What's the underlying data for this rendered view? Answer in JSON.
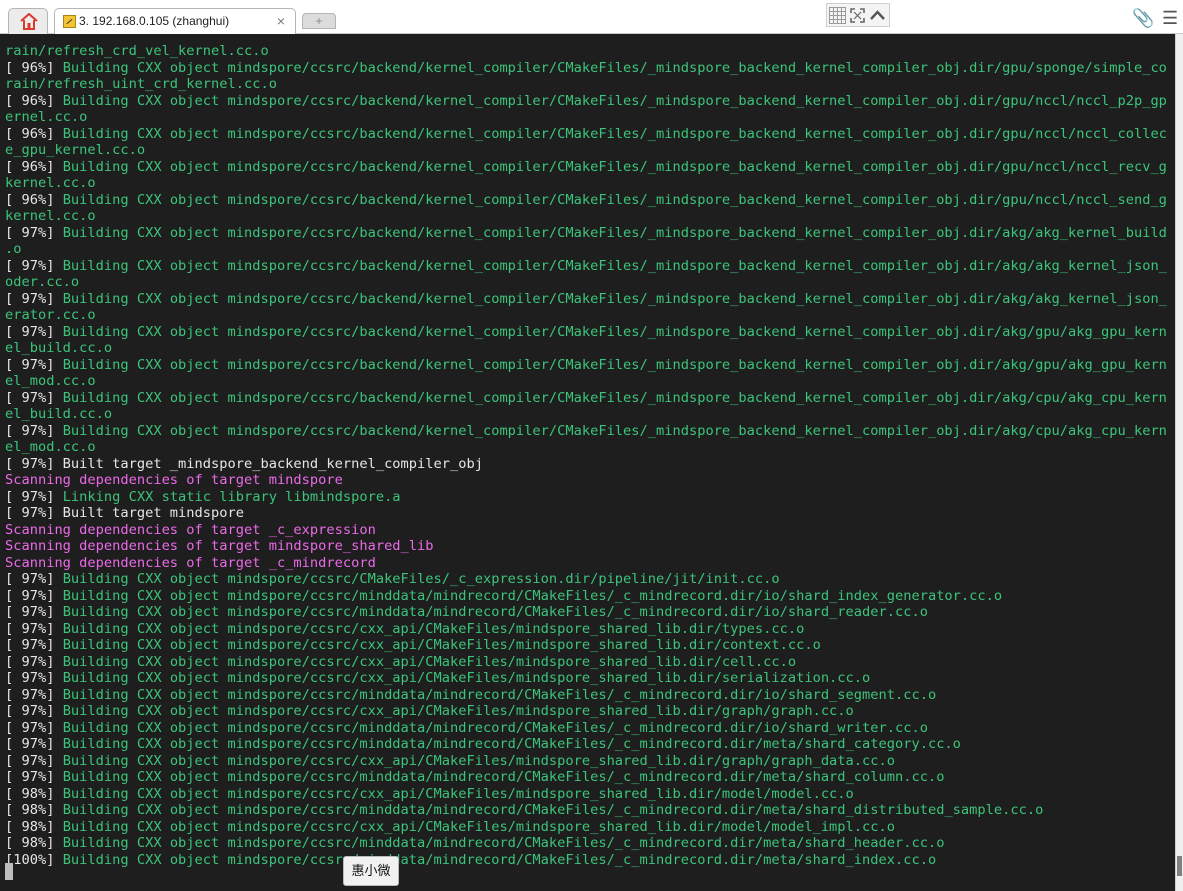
{
  "tabs": {
    "home_icon": "home-icon",
    "session_title": "3. 192.168.0.105 (zhanghui)",
    "close_glyph": "×",
    "new_tab_glyph": "+"
  },
  "toolbar": {
    "icons": [
      "grid-icon",
      "fullscreen-icon",
      "collapse-icon",
      "paperclip-icon",
      "menu-icon"
    ],
    "paperclip_glyph": "📎",
    "menu_glyph": "☰"
  },
  "colors": {
    "terminal_background": "#1e1e1e",
    "default_text": "#e6e6e6",
    "progress_text": "#3cc47a",
    "scanning_text": "#ea6ae8",
    "home_icon": "#d83a2e",
    "paperclip": "#3a6bc7"
  },
  "terminal": {
    "lines": [
      {
        "parts": [
          {
            "c": "green",
            "t": "rain/refresh_crd_vel_kernel.cc.o"
          }
        ]
      },
      {
        "parts": [
          {
            "c": "white",
            "t": "[ 96%] "
          },
          {
            "c": "green",
            "t": "Building CXX object mindspore/ccsrc/backend/kernel_compiler/CMakeFiles/_mindspore_backend_kernel_compiler_obj.dir/gpu/sponge/simple_co"
          }
        ]
      },
      {
        "parts": [
          {
            "c": "green",
            "t": "rain/refresh_uint_crd_kernel.cc.o"
          }
        ]
      },
      {
        "parts": [
          {
            "c": "white",
            "t": "[ 96%] "
          },
          {
            "c": "green",
            "t": "Building CXX object mindspore/ccsrc/backend/kernel_compiler/CMakeFiles/_mindspore_backend_kernel_compiler_obj.dir/gpu/nccl/nccl_p2p_gp"
          }
        ]
      },
      {
        "parts": [
          {
            "c": "green",
            "t": "ernel.cc.o"
          }
        ]
      },
      {
        "parts": [
          {
            "c": "white",
            "t": "[ 96%] "
          },
          {
            "c": "green",
            "t": "Building CXX object mindspore/ccsrc/backend/kernel_compiler/CMakeFiles/_mindspore_backend_kernel_compiler_obj.dir/gpu/nccl/nccl_collec"
          }
        ]
      },
      {
        "parts": [
          {
            "c": "green",
            "t": "e_gpu_kernel.cc.o"
          }
        ]
      },
      {
        "parts": [
          {
            "c": "white",
            "t": "[ 96%] "
          },
          {
            "c": "green",
            "t": "Building CXX object mindspore/ccsrc/backend/kernel_compiler/CMakeFiles/_mindspore_backend_kernel_compiler_obj.dir/gpu/nccl/nccl_recv_g"
          }
        ]
      },
      {
        "parts": [
          {
            "c": "green",
            "t": "kernel.cc.o"
          }
        ]
      },
      {
        "parts": [
          {
            "c": "white",
            "t": "[ 96%] "
          },
          {
            "c": "green",
            "t": "Building CXX object mindspore/ccsrc/backend/kernel_compiler/CMakeFiles/_mindspore_backend_kernel_compiler_obj.dir/gpu/nccl/nccl_send_g"
          }
        ]
      },
      {
        "parts": [
          {
            "c": "green",
            "t": "kernel.cc.o"
          }
        ]
      },
      {
        "parts": [
          {
            "c": "white",
            "t": "[ 97%] "
          },
          {
            "c": "green",
            "t": "Building CXX object mindspore/ccsrc/backend/kernel_compiler/CMakeFiles/_mindspore_backend_kernel_compiler_obj.dir/akg/akg_kernel_build"
          }
        ]
      },
      {
        "parts": [
          {
            "c": "green",
            "t": ".o"
          }
        ]
      },
      {
        "parts": [
          {
            "c": "white",
            "t": "[ 97%] "
          },
          {
            "c": "green",
            "t": "Building CXX object mindspore/ccsrc/backend/kernel_compiler/CMakeFiles/_mindspore_backend_kernel_compiler_obj.dir/akg/akg_kernel_json_"
          }
        ]
      },
      {
        "parts": [
          {
            "c": "green",
            "t": "oder.cc.o"
          }
        ]
      },
      {
        "parts": [
          {
            "c": "white",
            "t": "[ 97%] "
          },
          {
            "c": "green",
            "t": "Building CXX object mindspore/ccsrc/backend/kernel_compiler/CMakeFiles/_mindspore_backend_kernel_compiler_obj.dir/akg/akg_kernel_json_"
          }
        ]
      },
      {
        "parts": [
          {
            "c": "green",
            "t": "erator.cc.o"
          }
        ]
      },
      {
        "parts": [
          {
            "c": "white",
            "t": "[ 97%] "
          },
          {
            "c": "green",
            "t": "Building CXX object mindspore/ccsrc/backend/kernel_compiler/CMakeFiles/_mindspore_backend_kernel_compiler_obj.dir/akg/gpu/akg_gpu_kern"
          }
        ]
      },
      {
        "parts": [
          {
            "c": "green",
            "t": "el_build.cc.o"
          }
        ]
      },
      {
        "parts": [
          {
            "c": "white",
            "t": "[ 97%] "
          },
          {
            "c": "green",
            "t": "Building CXX object mindspore/ccsrc/backend/kernel_compiler/CMakeFiles/_mindspore_backend_kernel_compiler_obj.dir/akg/gpu/akg_gpu_kern"
          }
        ]
      },
      {
        "parts": [
          {
            "c": "green",
            "t": "el_mod.cc.o"
          }
        ]
      },
      {
        "parts": [
          {
            "c": "white",
            "t": "[ 97%] "
          },
          {
            "c": "green",
            "t": "Building CXX object mindspore/ccsrc/backend/kernel_compiler/CMakeFiles/_mindspore_backend_kernel_compiler_obj.dir/akg/cpu/akg_cpu_kern"
          }
        ]
      },
      {
        "parts": [
          {
            "c": "green",
            "t": "el_build.cc.o"
          }
        ]
      },
      {
        "parts": [
          {
            "c": "white",
            "t": "[ 97%] "
          },
          {
            "c": "green",
            "t": "Building CXX object mindspore/ccsrc/backend/kernel_compiler/CMakeFiles/_mindspore_backend_kernel_compiler_obj.dir/akg/cpu/akg_cpu_kern"
          }
        ]
      },
      {
        "parts": [
          {
            "c": "green",
            "t": "el_mod.cc.o"
          }
        ]
      },
      {
        "parts": [
          {
            "c": "white",
            "t": "[ 97%] Built target _mindspore_backend_kernel_compiler_obj"
          }
        ]
      },
      {
        "parts": [
          {
            "c": "magenta",
            "t": "Scanning dependencies of target mindspore"
          }
        ]
      },
      {
        "parts": [
          {
            "c": "white",
            "t": "[ 97%] "
          },
          {
            "c": "green",
            "t": "Linking CXX static library libmindspore.a"
          }
        ]
      },
      {
        "parts": [
          {
            "c": "white",
            "t": "[ 97%] Built target mindspore"
          }
        ]
      },
      {
        "parts": [
          {
            "c": "magenta",
            "t": "Scanning dependencies of target _c_expression"
          }
        ]
      },
      {
        "parts": [
          {
            "c": "magenta",
            "t": "Scanning dependencies of target mindspore_shared_lib"
          }
        ]
      },
      {
        "parts": [
          {
            "c": "magenta",
            "t": "Scanning dependencies of target _c_mindrecord"
          }
        ]
      },
      {
        "parts": [
          {
            "c": "white",
            "t": "[ 97%] "
          },
          {
            "c": "green",
            "t": "Building CXX object mindspore/ccsrc/CMakeFiles/_c_expression.dir/pipeline/jit/init.cc.o"
          }
        ]
      },
      {
        "parts": [
          {
            "c": "white",
            "t": "[ 97%] "
          },
          {
            "c": "green",
            "t": "Building CXX object mindspore/ccsrc/minddata/mindrecord/CMakeFiles/_c_mindrecord.dir/io/shard_index_generator.cc.o"
          }
        ]
      },
      {
        "parts": [
          {
            "c": "white",
            "t": "[ 97%] "
          },
          {
            "c": "green",
            "t": "Building CXX object mindspore/ccsrc/minddata/mindrecord/CMakeFiles/_c_mindrecord.dir/io/shard_reader.cc.o"
          }
        ]
      },
      {
        "parts": [
          {
            "c": "white",
            "t": "[ 97%] "
          },
          {
            "c": "green",
            "t": "Building CXX object mindspore/ccsrc/cxx_api/CMakeFiles/mindspore_shared_lib.dir/types.cc.o"
          }
        ]
      },
      {
        "parts": [
          {
            "c": "white",
            "t": "[ 97%] "
          },
          {
            "c": "green",
            "t": "Building CXX object mindspore/ccsrc/cxx_api/CMakeFiles/mindspore_shared_lib.dir/context.cc.o"
          }
        ]
      },
      {
        "parts": [
          {
            "c": "white",
            "t": "[ 97%] "
          },
          {
            "c": "green",
            "t": "Building CXX object mindspore/ccsrc/cxx_api/CMakeFiles/mindspore_shared_lib.dir/cell.cc.o"
          }
        ]
      },
      {
        "parts": [
          {
            "c": "white",
            "t": "[ 97%] "
          },
          {
            "c": "green",
            "t": "Building CXX object mindspore/ccsrc/cxx_api/CMakeFiles/mindspore_shared_lib.dir/serialization.cc.o"
          }
        ]
      },
      {
        "parts": [
          {
            "c": "white",
            "t": "[ 97%] "
          },
          {
            "c": "green",
            "t": "Building CXX object mindspore/ccsrc/minddata/mindrecord/CMakeFiles/_c_mindrecord.dir/io/shard_segment.cc.o"
          }
        ]
      },
      {
        "parts": [
          {
            "c": "white",
            "t": "[ 97%] "
          },
          {
            "c": "green",
            "t": "Building CXX object mindspore/ccsrc/cxx_api/CMakeFiles/mindspore_shared_lib.dir/graph/graph.cc.o"
          }
        ]
      },
      {
        "parts": [
          {
            "c": "white",
            "t": "[ 97%] "
          },
          {
            "c": "green",
            "t": "Building CXX object mindspore/ccsrc/minddata/mindrecord/CMakeFiles/_c_mindrecord.dir/io/shard_writer.cc.o"
          }
        ]
      },
      {
        "parts": [
          {
            "c": "white",
            "t": "[ 97%] "
          },
          {
            "c": "green",
            "t": "Building CXX object mindspore/ccsrc/minddata/mindrecord/CMakeFiles/_c_mindrecord.dir/meta/shard_category.cc.o"
          }
        ]
      },
      {
        "parts": [
          {
            "c": "white",
            "t": "[ 97%] "
          },
          {
            "c": "green",
            "t": "Building CXX object mindspore/ccsrc/cxx_api/CMakeFiles/mindspore_shared_lib.dir/graph/graph_data.cc.o"
          }
        ]
      },
      {
        "parts": [
          {
            "c": "white",
            "t": "[ 97%] "
          },
          {
            "c": "green",
            "t": "Building CXX object mindspore/ccsrc/minddata/mindrecord/CMakeFiles/_c_mindrecord.dir/meta/shard_column.cc.o"
          }
        ]
      },
      {
        "parts": [
          {
            "c": "white",
            "t": "[ 98%] "
          },
          {
            "c": "green",
            "t": "Building CXX object mindspore/ccsrc/cxx_api/CMakeFiles/mindspore_shared_lib.dir/model/model.cc.o"
          }
        ]
      },
      {
        "parts": [
          {
            "c": "white",
            "t": "[ 98%] "
          },
          {
            "c": "green",
            "t": "Building CXX object mindspore/ccsrc/minddata/mindrecord/CMakeFiles/_c_mindrecord.dir/meta/shard_distributed_sample.cc.o"
          }
        ]
      },
      {
        "parts": [
          {
            "c": "white",
            "t": "[ 98%] "
          },
          {
            "c": "green",
            "t": "Building CXX object mindspore/ccsrc/cxx_api/CMakeFiles/mindspore_shared_lib.dir/model/model_impl.cc.o"
          }
        ]
      },
      {
        "parts": [
          {
            "c": "white",
            "t": "[ 98%] "
          },
          {
            "c": "green",
            "t": "Building CXX object mindspore/ccsrc/minddata/mindrecord/CMakeFiles/_c_mindrecord.dir/meta/shard_header.cc.o"
          }
        ]
      },
      {
        "parts": [
          {
            "c": "white",
            "t": "[100%] "
          },
          {
            "c": "green",
            "t": "Building CXX object mindspore/ccsrc/minddata/mindrecord/CMakeFiles/_c_mindrecord.dir/meta/shard_index.cc.o"
          }
        ]
      }
    ]
  },
  "tooltip": {
    "text": "惠小微"
  }
}
